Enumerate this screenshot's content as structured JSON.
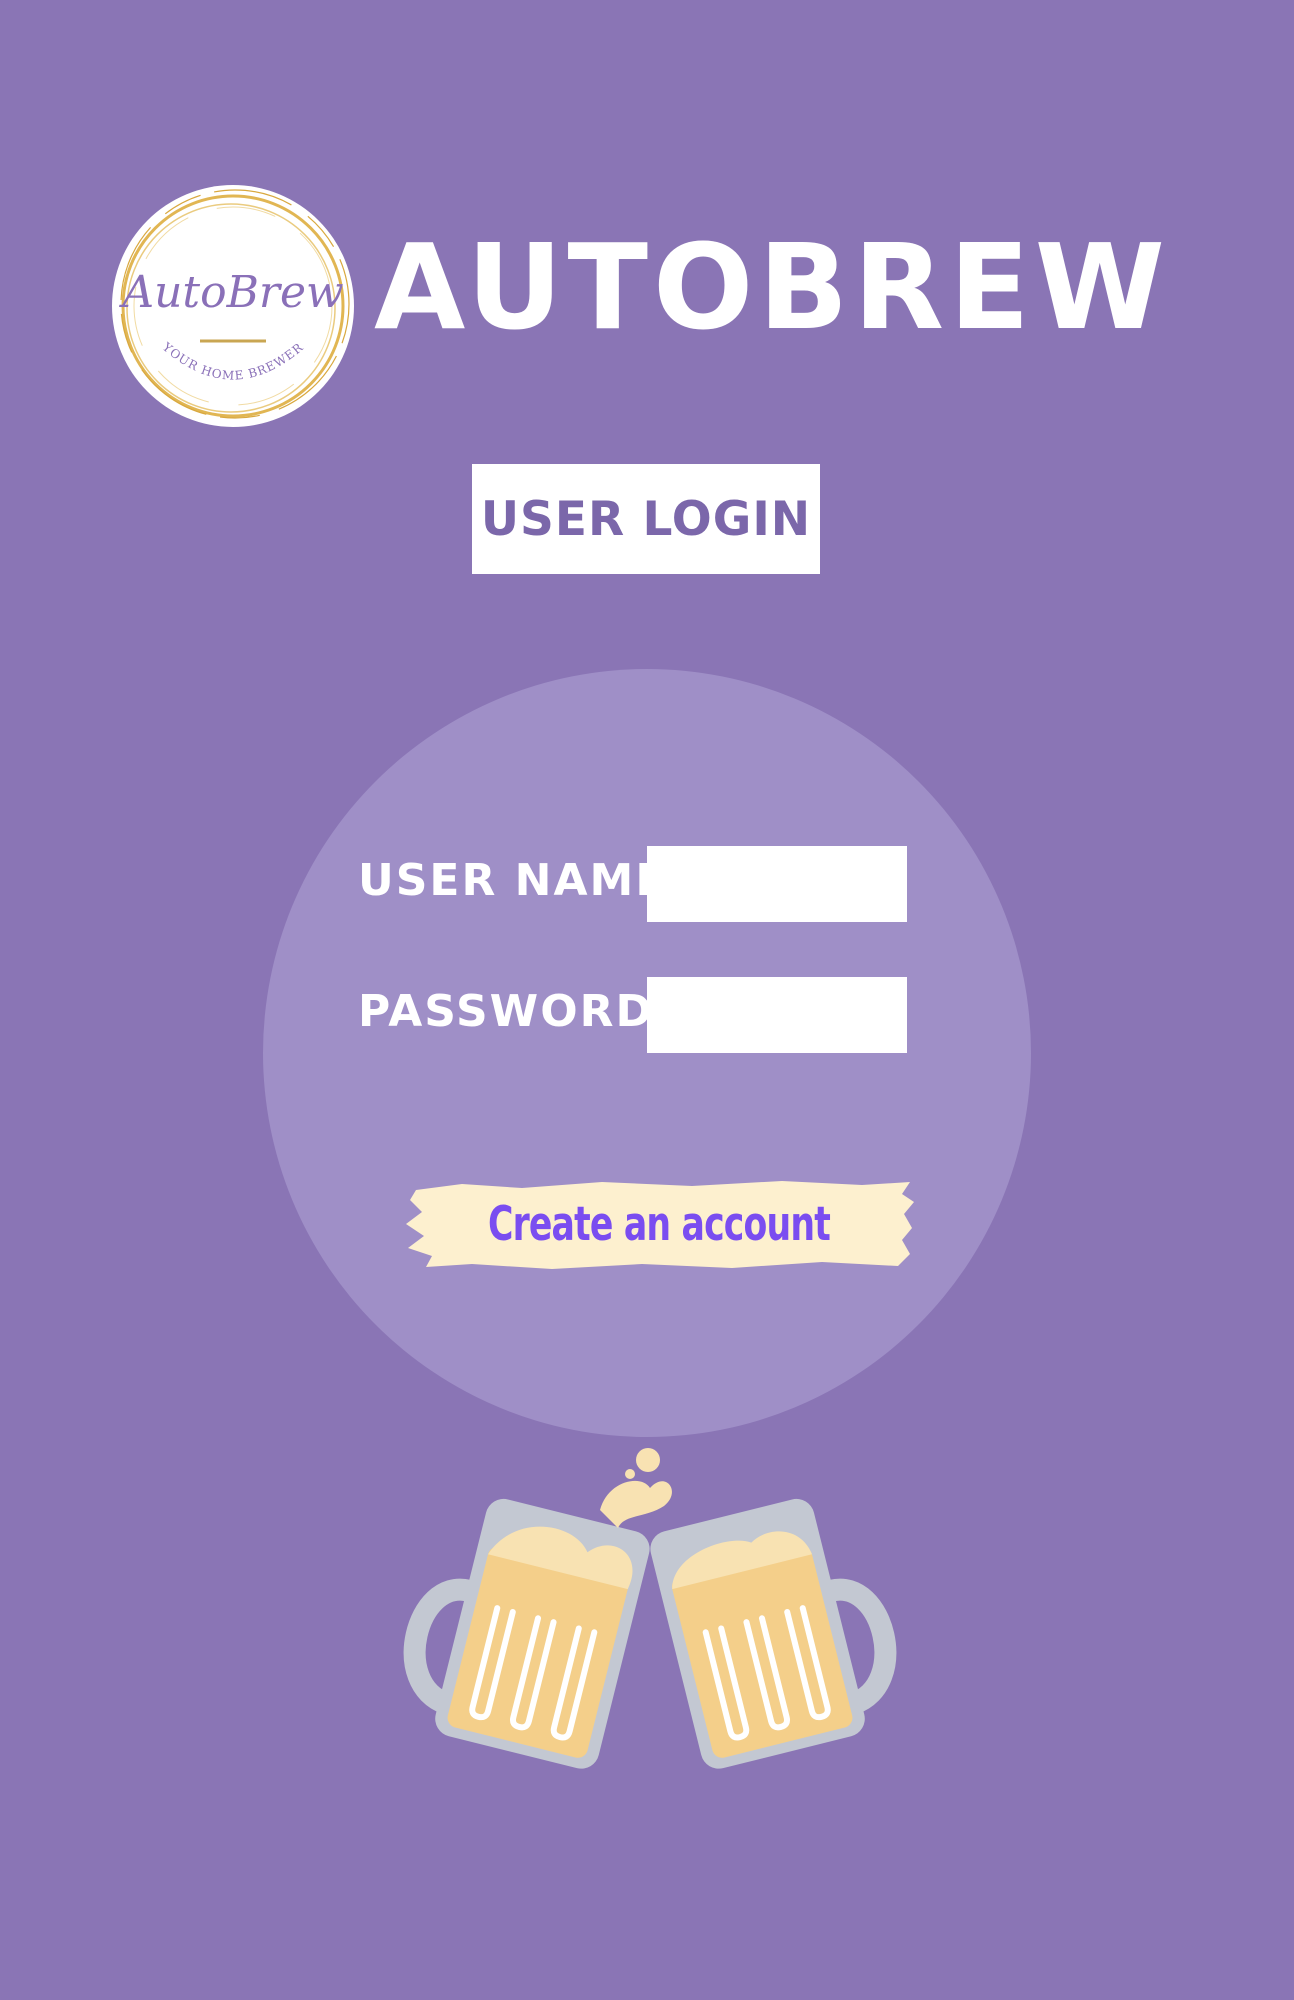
{
  "brand": {
    "logo_script": "AutoBrew",
    "logo_tagline": "YOUR HOME BREWER",
    "app_title": "AUTOBREW"
  },
  "login": {
    "badge_label": "USER LOGIN",
    "username_label": "USER NAME",
    "username_value": "",
    "password_label": "PASSWORD",
    "password_value": "",
    "create_account_label": "Create an account"
  },
  "colors": {
    "background": "#8a75b5",
    "panel": "#9f8fc7",
    "accent": "#7a4df0",
    "badge_text": "#7b67aa",
    "highlight": "#fdf0cf"
  },
  "icons": {
    "logo": "autobrew-logo",
    "illustration": "beer-mugs-cheers-icon"
  }
}
